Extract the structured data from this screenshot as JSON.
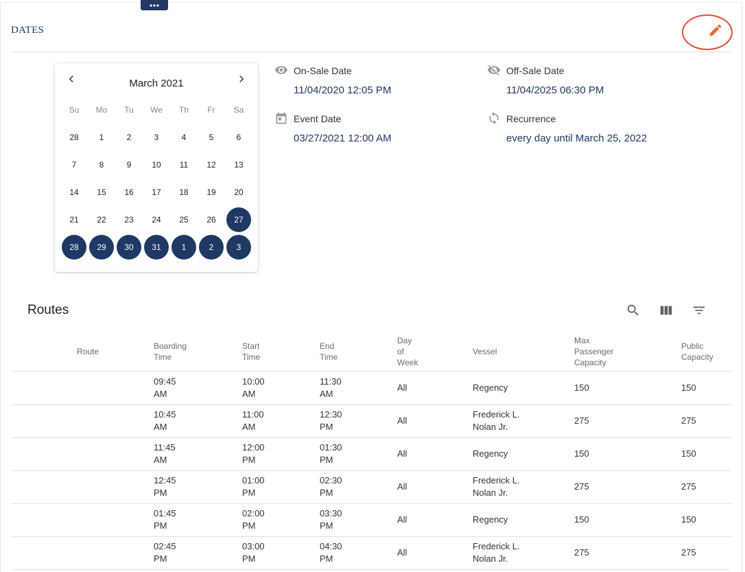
{
  "section": {
    "title": "DATES"
  },
  "calendar": {
    "month_label": "March 2021",
    "weekdays": [
      "Su",
      "Mo",
      "Tu",
      "We",
      "Th",
      "Fr",
      "Sa"
    ],
    "weeks": [
      [
        "28",
        "1",
        "2",
        "3",
        "4",
        "5",
        "6"
      ],
      [
        "7",
        "8",
        "9",
        "10",
        "11",
        "12",
        "13"
      ],
      [
        "14",
        "15",
        "16",
        "17",
        "18",
        "19",
        "20"
      ],
      [
        "21",
        "22",
        "23",
        "24",
        "25",
        "26",
        "27"
      ],
      [
        "28",
        "29",
        "30",
        "31",
        "1",
        "2",
        "3"
      ]
    ],
    "selected_days": [
      "27",
      "28",
      "29",
      "30",
      "31",
      "1",
      "2",
      "3"
    ]
  },
  "fields": {
    "on_sale": {
      "label": "On-Sale Date",
      "value": "11/04/2020 12:05 PM",
      "icon": "eye-icon"
    },
    "off_sale": {
      "label": "Off-Sale Date",
      "value": "11/04/2025 06:30 PM",
      "icon": "eye-off-icon"
    },
    "event_date": {
      "label": "Event Date",
      "value": "03/27/2021 12:00 AM",
      "icon": "calendar-icon"
    },
    "recurrence": {
      "label": "Recurrence",
      "value": "every day until March 25, 2022",
      "icon": "repeat-icon"
    }
  },
  "routes": {
    "title": "Routes",
    "toolbar_icons": [
      "search-icon",
      "columns-icon",
      "filter-icon"
    ],
    "headers": [
      [
        "Route"
      ],
      [
        "Boarding",
        "Time"
      ],
      [
        "Start",
        "Time"
      ],
      [
        "End",
        "Time"
      ],
      [
        "Day",
        "of",
        "Week"
      ],
      [
        "Vessel"
      ],
      [
        "Max",
        "Passenger",
        "Capacity"
      ],
      [
        "Public",
        "Capacity"
      ]
    ],
    "rows": [
      {
        "route": "",
        "boarding": [
          "09:45",
          "AM"
        ],
        "start": [
          "10:00",
          "AM"
        ],
        "end": [
          "11:30",
          "AM"
        ],
        "dow": "All",
        "vessel": [
          "Regency"
        ],
        "max_capacity": "150",
        "public_capacity": "150"
      },
      {
        "route": "",
        "boarding": [
          "10:45",
          "AM"
        ],
        "start": [
          "11:00",
          "AM"
        ],
        "end": [
          "12:30",
          "PM"
        ],
        "dow": "All",
        "vessel": [
          "Frederick L.",
          "Nolan Jr."
        ],
        "max_capacity": "275",
        "public_capacity": "275"
      },
      {
        "route": "",
        "boarding": [
          "11:45",
          "AM"
        ],
        "start": [
          "12:00",
          "PM"
        ],
        "end": [
          "01:30",
          "PM"
        ],
        "dow": "All",
        "vessel": [
          "Regency"
        ],
        "max_capacity": "150",
        "public_capacity": "150"
      },
      {
        "route": "",
        "boarding": [
          "12:45",
          "PM"
        ],
        "start": [
          "01:00",
          "PM"
        ],
        "end": [
          "02:30",
          "PM"
        ],
        "dow": "All",
        "vessel": [
          "Frederick L.",
          "Nolan Jr."
        ],
        "max_capacity": "275",
        "public_capacity": "275"
      },
      {
        "route": "",
        "boarding": [
          "01:45",
          "PM"
        ],
        "start": [
          "02:00",
          "PM"
        ],
        "end": [
          "03:30",
          "PM"
        ],
        "dow": "All",
        "vessel": [
          "Regency"
        ],
        "max_capacity": "150",
        "public_capacity": "150"
      },
      {
        "route": "",
        "boarding": [
          "02:45",
          "PM"
        ],
        "start": [
          "03:00",
          "PM"
        ],
        "end": [
          "04:30",
          "PM"
        ],
        "dow": "All",
        "vessel": [
          "Frederick L.",
          "Nolan Jr."
        ],
        "max_capacity": "275",
        "public_capacity": "275"
      }
    ]
  },
  "colors": {
    "accent": "#1f3864",
    "edit_icon": "#e9692c",
    "highlight_ring": "#e04b35"
  }
}
